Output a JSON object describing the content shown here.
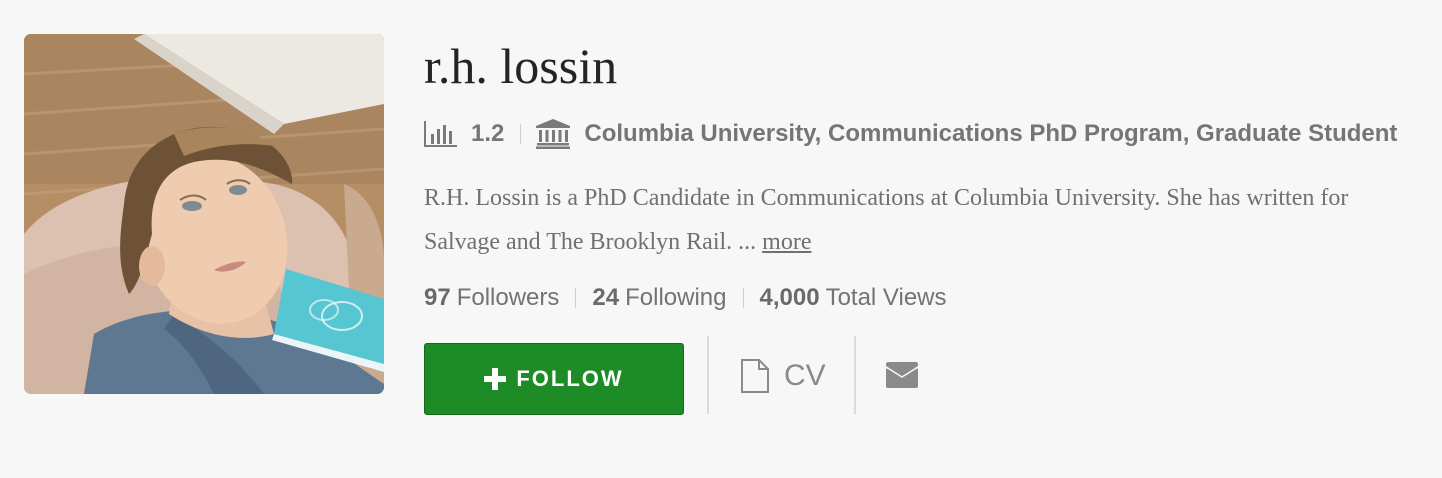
{
  "profile": {
    "name": "r.h. lossin",
    "score": "1.2",
    "affiliation": "Columbia University, Communications PhD Program, Graduate Student",
    "bio_line1": "R.H. Lossin is a PhD Candidate in Communications at Columbia University.  She has written for",
    "bio_line2": "Salvage and The Brooklyn Rail. ... ",
    "bio_more": "more",
    "icons": {
      "score": "bar-chart-icon",
      "affiliation": "institution-icon",
      "follow": "plus-icon",
      "cv": "document-icon",
      "message": "envelope-icon"
    }
  },
  "stats": {
    "followers_count": "97",
    "followers_label": "Followers",
    "following_count": "24",
    "following_label": "Following",
    "views_count": "4,000",
    "views_label": "Total Views"
  },
  "actions": {
    "follow_label": "FOLLOW",
    "cv_label": "CV"
  },
  "colors": {
    "follow_button": "#1d8b26",
    "background": "#f7f7f7",
    "name_text": "#242424"
  }
}
